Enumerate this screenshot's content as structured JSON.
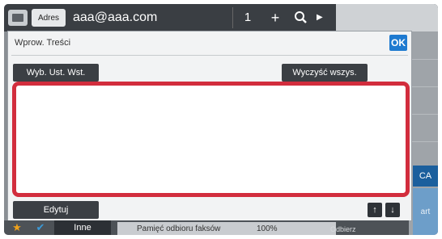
{
  "topbar": {
    "address_button_label": "Adres",
    "address_value": "aaa@aaa.com",
    "count": "1",
    "plus_symbol": "+",
    "search_icon": "search-icon",
    "play_icon": "play-icon"
  },
  "dialog": {
    "title": "Wprow. Treści",
    "ok_label": "OK",
    "select_default_label": "Wyb. Ust. Wst.",
    "clear_all_label": "Wyczyść wszys.",
    "text_content": "",
    "edit_label": "Edytuj",
    "arrow_up": "↑",
    "arrow_down": "↓"
  },
  "side": {
    "ca_label": "CA",
    "start_label": "art"
  },
  "bottombar": {
    "other_label": "Inne",
    "status_label": "Pamięć odbioru faksów",
    "status_value": "100%",
    "receive_label": "Odbierz"
  },
  "colors": {
    "highlight": "#d22d3d",
    "ok_blue": "#1e7ad0",
    "ca_blue": "#1b5f9d"
  }
}
